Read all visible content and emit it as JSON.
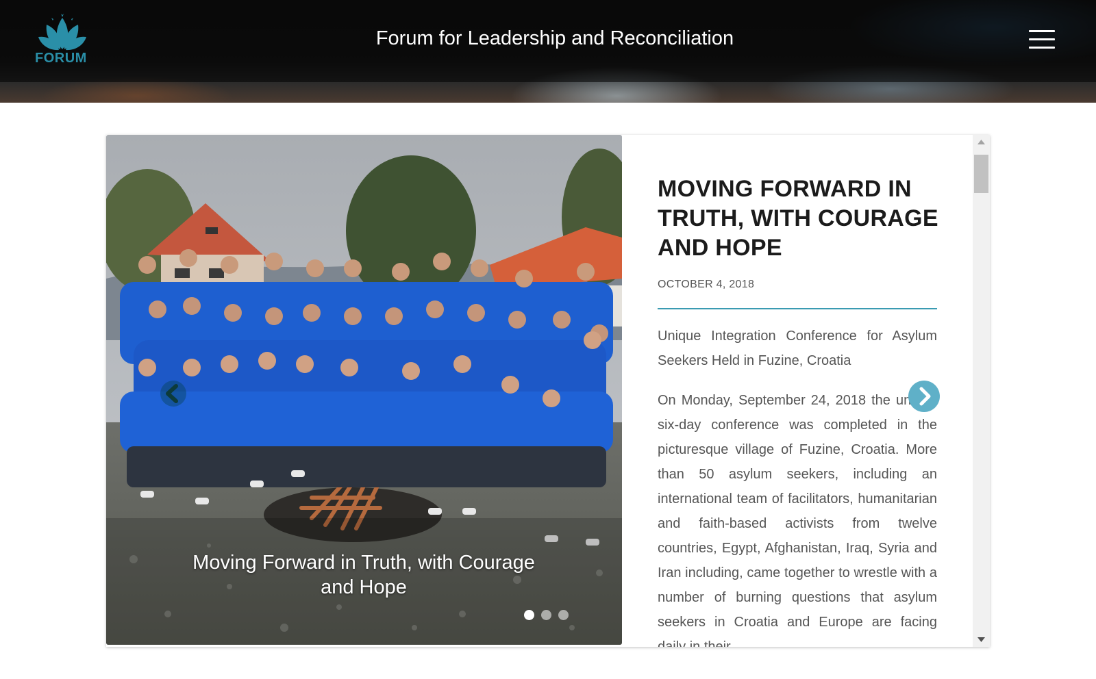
{
  "header": {
    "logo_text": "FORUM",
    "site_title": "Forum for Leadership and Reconciliation",
    "menu_icon": "hamburger-menu-icon"
  },
  "slider": {
    "caption": "Moving Forward in Truth, with Courage and Hope",
    "slide_count": 3,
    "active_slide": 1,
    "prev_icon": "chevron-left-icon",
    "next_icon": "chevron-right-icon"
  },
  "article": {
    "title": "MOVING FORWARD IN TRUTH, WITH COURAGE AND HOPE",
    "date": "OCTOBER 4, 2018",
    "subtitle": "Unique Integration Conference for Asylum Seekers Held in Fuzine, Croatia",
    "body": "On Monday, September 24, 2018 the unique six-day conference was completed in the picturesque village of Fuzine, Croatia. More than 50 asylum seekers, including an international team of facilitators, humanitarian and faith-based activists from twelve countries, Egypt, Afghanistan, Iraq, Syria and Iran including, came together to wrestle with a number of burning questions that asylum seekers in Croatia and Europe are facing daily in their"
  },
  "colors": {
    "accent": "#3a9bb2",
    "logo": "#2a8fa8",
    "next_arrow": "#5fb0c8",
    "shirt_blue": "#1e5fd0"
  }
}
